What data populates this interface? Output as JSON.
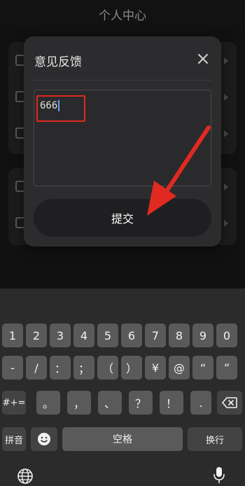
{
  "background": {
    "title": "个人中心"
  },
  "dialog": {
    "title": "意见反馈",
    "close_icon": "close-icon",
    "input_value": "666",
    "submit_label": "提交"
  },
  "keyboard": {
    "row1": [
      "1",
      "2",
      "3",
      "4",
      "5",
      "6",
      "7",
      "8",
      "9",
      "0"
    ],
    "row2": [
      "-",
      "/",
      "：",
      "；",
      "（",
      "）",
      "¥",
      "@",
      "“",
      "”"
    ],
    "row3": [
      "。",
      "，",
      "、",
      "？",
      "！",
      "."
    ],
    "mode_label": "#+=",
    "backspace_icon": "backspace-icon",
    "pinyin_label": "拼音",
    "emoji_icon": "emoji-icon",
    "space_label": "空格",
    "return_label": "换行",
    "globe_icon": "globe-icon",
    "mic_icon": "microphone-icon"
  },
  "colors": {
    "annotation_red": "#e02a20",
    "dialog_bg": "#2c2c2e",
    "key_bg": "#5a5a5a"
  }
}
